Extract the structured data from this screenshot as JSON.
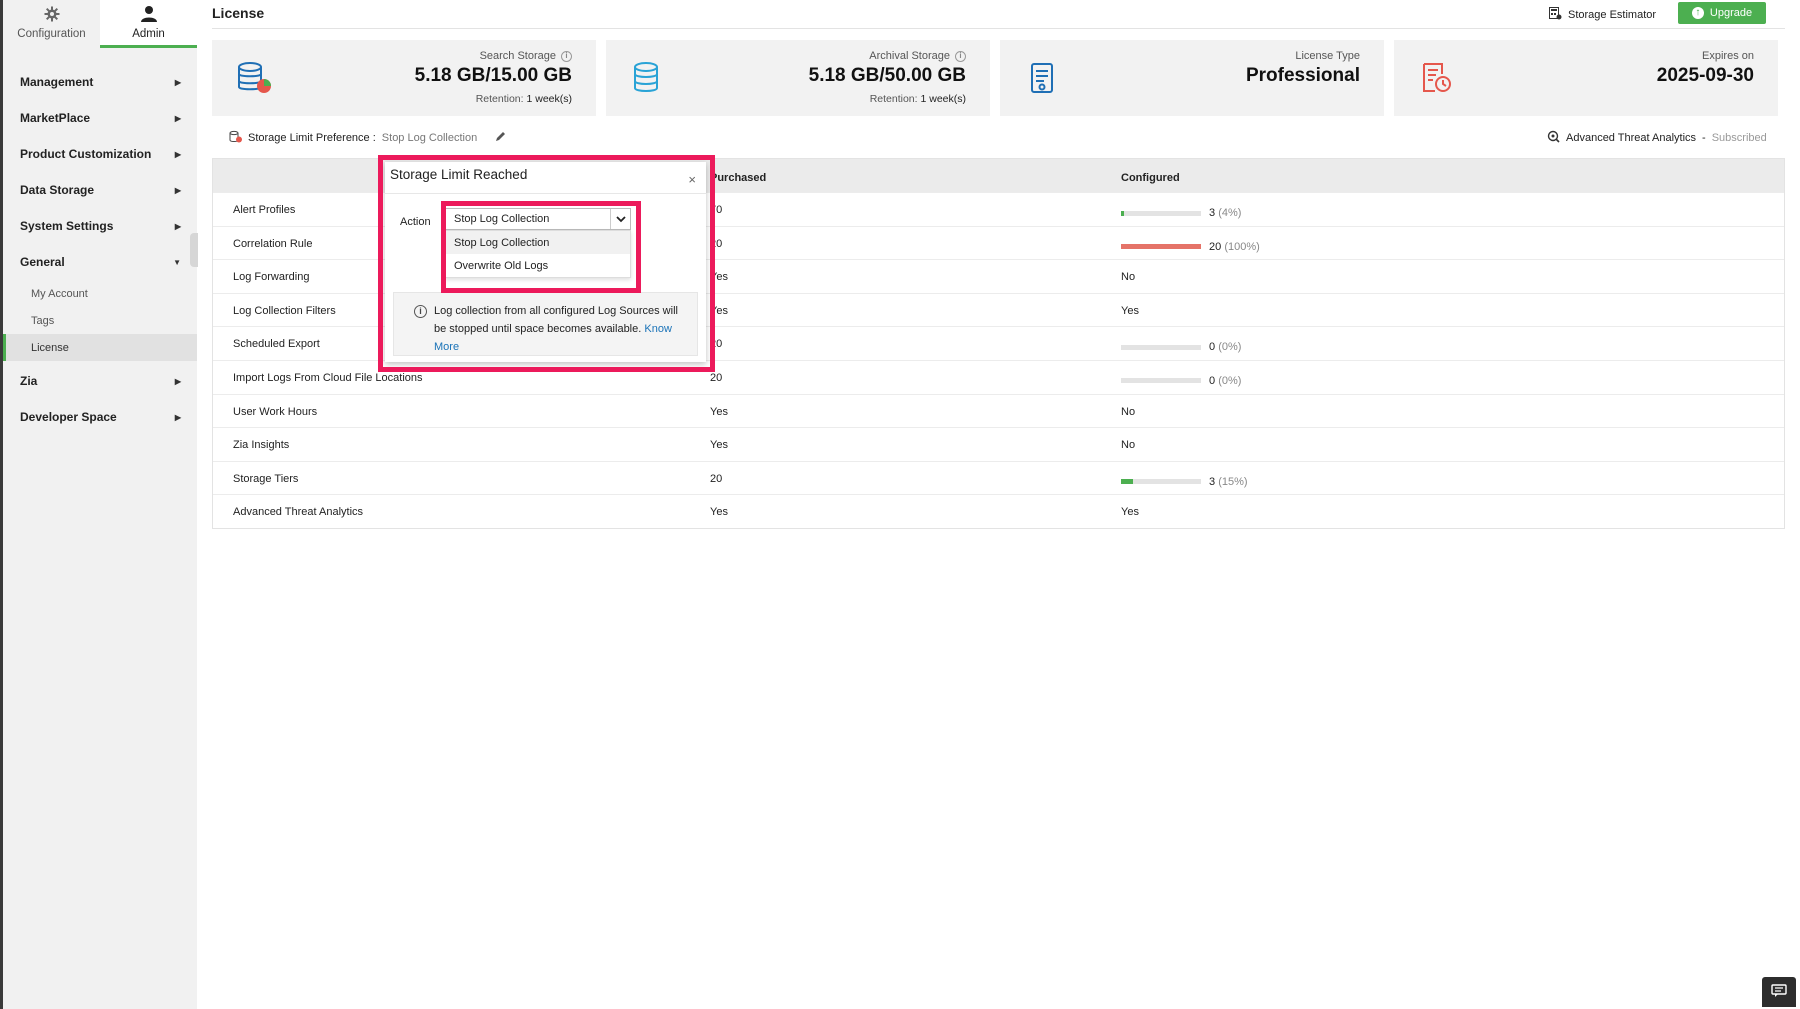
{
  "sidebar": {
    "tabs": [
      {
        "label": "Configuration",
        "icon": "gear-icon"
      },
      {
        "label": "Admin",
        "icon": "user-icon"
      }
    ],
    "menu": {
      "management": "Management",
      "marketplace": "MarketPlace",
      "product_customization": "Product Customization",
      "data_storage": "Data Storage",
      "system_settings": "System Settings",
      "general": "General",
      "general_sub": [
        "My Account",
        "Tags",
        "License"
      ],
      "zia": "Zia",
      "developer_space": "Developer Space"
    }
  },
  "header": {
    "title": "License",
    "storage_estimator": "Storage Estimator",
    "upgrade": "Upgrade"
  },
  "cards": [
    {
      "label": "Search Storage",
      "value": "5.18 GB/15.00 GB",
      "retention_label": "Retention:",
      "retention_value": "1 week(s)"
    },
    {
      "label": "Archival Storage",
      "value": "5.18 GB/50.00 GB",
      "retention_label": "Retention:",
      "retention_value": "1 week(s)"
    },
    {
      "label": "License Type",
      "value": "Professional"
    },
    {
      "label": "Expires on",
      "value": "2025-09-30"
    }
  ],
  "preference": {
    "label": "Storage Limit Preference :",
    "value": "Stop Log Collection"
  },
  "ata": {
    "label": "Advanced Threat Analytics",
    "separator": "-",
    "status": "Subscribed"
  },
  "table": {
    "headers": {
      "purchased": "Purchased",
      "configured": "Configured"
    },
    "rows": [
      {
        "name": "Alert Profiles",
        "purchased": "70",
        "count": "3",
        "pct": "(4%)"
      },
      {
        "name": "Correlation Rule",
        "purchased": "20",
        "count": "20",
        "pct": "(100%)"
      },
      {
        "name": "Log Forwarding",
        "purchased": "Yes",
        "configured": "No"
      },
      {
        "name": "Log Collection Filters",
        "purchased": "Yes",
        "configured": "Yes"
      },
      {
        "name": "Scheduled Export",
        "purchased": "20",
        "count": "0",
        "pct": "(0%)"
      },
      {
        "name": "Import Logs From Cloud File Locations",
        "purchased": "20",
        "count": "0",
        "pct": "(0%)"
      },
      {
        "name": "User Work Hours",
        "purchased": "Yes",
        "configured": "No"
      },
      {
        "name": "Zia Insights",
        "purchased": "Yes",
        "configured": "No"
      },
      {
        "name": "Storage Tiers",
        "purchased": "20",
        "count": "3",
        "pct": "(15%)"
      },
      {
        "name": "Advanced Threat Analytics",
        "purchased": "Yes",
        "configured": "Yes"
      }
    ],
    "bar_fractions": {
      "alert_profiles": 0.04,
      "correlation_rule": 1.0,
      "scheduled_export": 0.0,
      "import_logs": 0.0,
      "storage_tiers": 0.15
    },
    "colors": {
      "low": "#4caf50",
      "full": "#e57368"
    }
  },
  "popup": {
    "title": "Storage Limit Reached",
    "close": "×",
    "action_label": "Action",
    "selected": "Stop Log Collection",
    "options": [
      "Stop Log Collection",
      "Overwrite Old Logs"
    ],
    "info_text": "Log collection from all configured Log Sources will be stopped until space becomes available.",
    "link_know": "Know",
    "link_more": "More"
  },
  "colors": {
    "accent": "#4caf50",
    "highlight": "#ec1a5b",
    "link": "#1a73b8"
  }
}
